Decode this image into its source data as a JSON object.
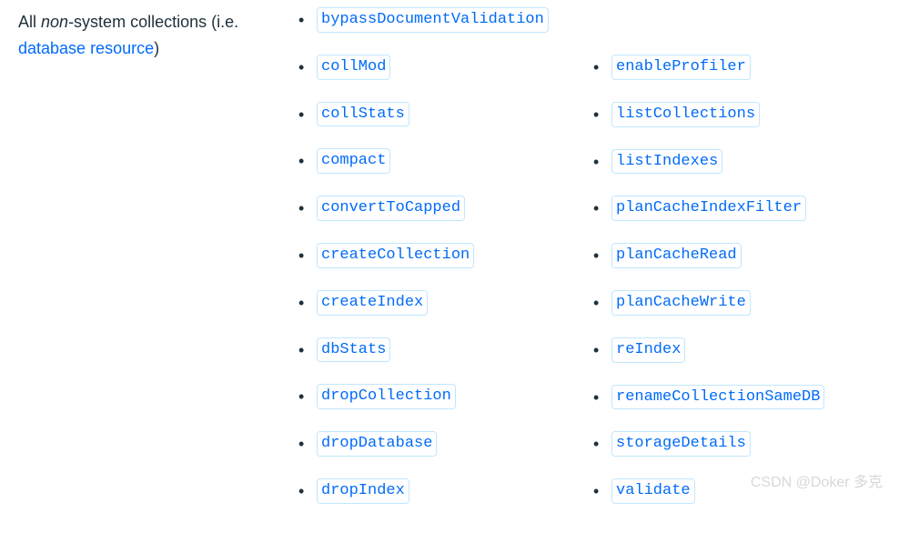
{
  "description": {
    "prefix": "All ",
    "italic": "non",
    "middle": "-system collections (i.e. ",
    "link": "database resource",
    "suffix": ")"
  },
  "columns": {
    "left": [
      "bypassDocumentValidation",
      "collMod",
      "collStats",
      "compact",
      "convertToCapped",
      "createCollection",
      "createIndex",
      "dbStats",
      "dropCollection",
      "dropDatabase",
      "dropIndex"
    ],
    "right": [
      "enableProfiler",
      "listCollections",
      "listIndexes",
      "planCacheIndexFilter",
      "planCacheRead",
      "planCacheWrite",
      "reIndex",
      "renameCollectionSameDB",
      "storageDetails",
      "validate"
    ]
  },
  "watermark": "CSDN @Doker 多克"
}
